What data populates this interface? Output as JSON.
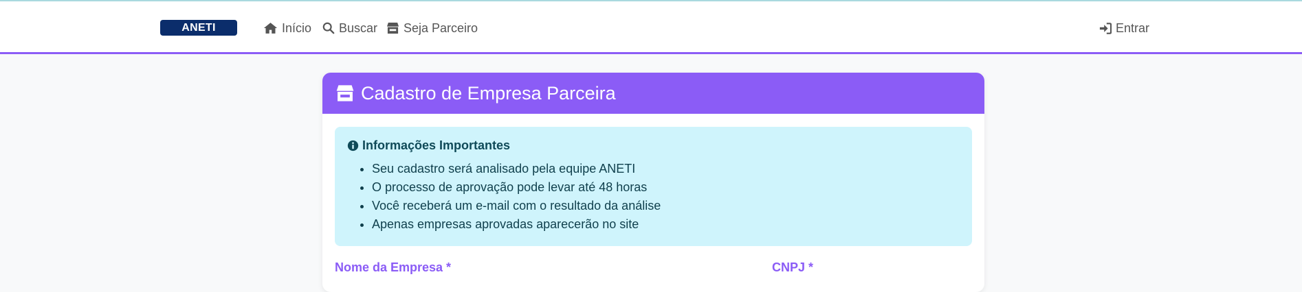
{
  "navbar": {
    "brand": "ANETI",
    "items": [
      {
        "label": "Início",
        "icon": "home-icon"
      },
      {
        "label": "Buscar",
        "icon": "search-icon"
      },
      {
        "label": "Seja Parceiro",
        "icon": "store-icon"
      }
    ],
    "login": {
      "label": "Entrar",
      "icon": "sign-in-icon"
    }
  },
  "card": {
    "title": "Cadastro de Empresa Parceira",
    "header_icon": "store-icon",
    "alert": {
      "icon": "info-circle-icon",
      "title": "Informações Importantes",
      "items": [
        "Seu cadastro será analisado pela equipe ANETI",
        "O processo de aprovação pode levar até 48 horas",
        "Você receberá um e-mail com o resultado da análise",
        "Apenas empresas aprovadas aparecerão no site"
      ]
    },
    "form": {
      "company_name_label": "Nome da Empresa *",
      "cnpj_label": "CNPJ *"
    }
  },
  "colors": {
    "accent": "#8b5cf6",
    "brand_bg": "#0b2d6b",
    "alert_bg": "#cff4fc",
    "alert_text": "#055160"
  }
}
